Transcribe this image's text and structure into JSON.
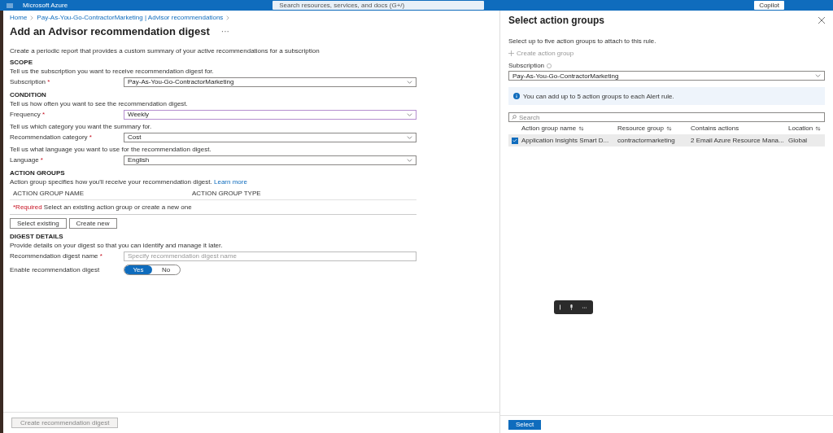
{
  "topbar": {
    "app_title": "Microsoft Azure",
    "search_placeholder": "Search resources, services, and docs (G+/)",
    "copilot_label": "Copilot"
  },
  "breadcrumb": [
    "Home",
    "Pay-As-You-Go-ContractorMarketing | Advisor recommendations"
  ],
  "page": {
    "title": "Add an Advisor recommendation digest",
    "more": "···",
    "blocks": [
      {
        "kind": "hint",
        "text": "Create a periodic report that provides a custom summary of your active recommendations for a subscription"
      },
      {
        "kind": "heading",
        "text": "SCOPE"
      },
      {
        "kind": "hint",
        "text": "Tell us the subscription you want to receive recommendation digest for."
      },
      {
        "kind": "select",
        "label": "Subscription",
        "required_mark": "*",
        "value": "Pay-As-You-Go-ContractorMarketing",
        "focused": false
      },
      {
        "kind": "heading",
        "text": "CONDITION"
      },
      {
        "kind": "hint",
        "text": "Tell us how often you want to see the recommendation digest."
      },
      {
        "kind": "select",
        "label": "Frequency",
        "required_mark": "*",
        "value": "Weekly",
        "focused": true
      },
      {
        "kind": "hint",
        "text": "Tell us which category you want the summary for."
      },
      {
        "kind": "select",
        "label": "Recommendation category",
        "required_mark": "*",
        "value": "Cost",
        "focused": false
      },
      {
        "kind": "hint",
        "text": "Tell us what language you want to use for the recommendation digest."
      },
      {
        "kind": "select",
        "label": "Language",
        "required_mark": "*",
        "value": "English",
        "focused": false
      },
      {
        "kind": "heading",
        "text": "ACTION GROUPS"
      },
      {
        "kind": "hint",
        "text": "Action group specifies how you'll receive your recommendation digest.",
        "link": "Learn more"
      },
      {
        "kind": "table_header",
        "columns": [
          "ACTION GROUP NAME",
          "ACTION GROUP TYPE"
        ]
      },
      {
        "kind": "required",
        "tag": "*Required",
        "text": "Select an existing action group or create a new one"
      },
      {
        "kind": "buttons",
        "buttons": [
          "Select existing",
          "Create new"
        ]
      },
      {
        "kind": "heading",
        "text": "DIGEST DETAILS"
      },
      {
        "kind": "hint",
        "text": "Provide details on your digest so that you can identify and manage it later."
      },
      {
        "kind": "input",
        "label": "Recommendation digest name",
        "required_mark": "*",
        "placeholder": "Specify recommendation digest name"
      },
      {
        "kind": "toggle",
        "label": "Enable recommendation digest",
        "options": [
          {
            "label": "Yes",
            "selected": true
          },
          {
            "label": "No",
            "selected": false
          }
        ]
      }
    ],
    "footer_button": {
      "label": "Create recommendation digest",
      "disabled": true
    }
  },
  "panel": {
    "title": "Select action groups",
    "intro": "Select up to five action groups to attach to this rule.",
    "create_action": {
      "label": "Create action group",
      "disabled": true
    },
    "subscription_label": "Subscription",
    "subscription_value": "Pay-As-You-Go-ContractorMarketing",
    "info": "You can add up to 5 action groups to each Alert rule.",
    "search_placeholder": "Search",
    "columns": [
      {
        "label": "Action group name",
        "sortable": true
      },
      {
        "label": "Resource group",
        "sortable": true
      },
      {
        "label": "Contains actions",
        "sortable": false
      },
      {
        "label": "Location",
        "sortable": true
      }
    ],
    "rows": [
      {
        "checked": true,
        "selected": true,
        "cells": [
          "Application Insights Smart D...",
          "contractormarketing",
          "2 Email Azure Resource Mana...",
          "Global"
        ]
      }
    ],
    "footer_button": "Select"
  }
}
